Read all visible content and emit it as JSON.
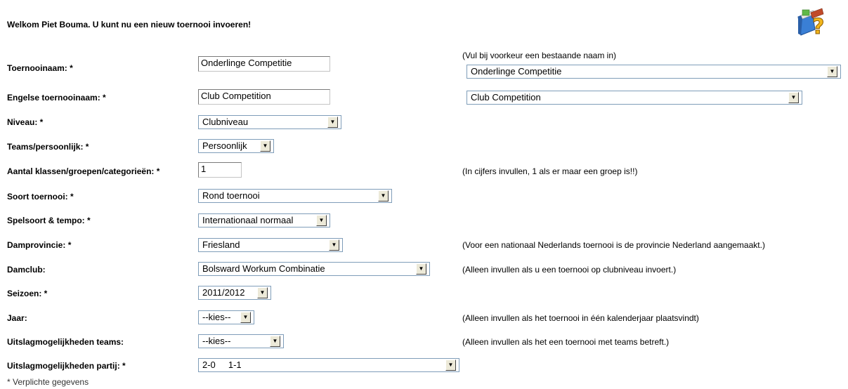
{
  "header": {
    "welcome": "Welkom Piet Bouma. U kunt nu een nieuw toernooi invoeren!"
  },
  "icons": {
    "help": "help-book-question-icon"
  },
  "form": {
    "tournament_name_label": "Toernooinaam: *",
    "tournament_name_value": "Onderlinge Competitie",
    "tournament_name_hint": "(Vul bij voorkeur een bestaande naam in)",
    "tournament_name_existing": "Onderlinge Competitie",
    "english_name_label": "Engelse toernooinaam: *",
    "english_name_value": "Club Competition",
    "english_name_existing": "Club Competition",
    "level_label": "Niveau: *",
    "level_value": "Clubniveau",
    "teams_label": "Teams/persoonlijk: *",
    "teams_value": "Persoonlijk",
    "groups_label": "Aantal klassen/groepen/categorieën: *",
    "groups_value": "1",
    "groups_hint": "(In cijfers invullen, 1 als er maar een groep is!!)",
    "type_label": "Soort toernooi: *",
    "type_value": "Rond toernooi",
    "game_label": "Spelsoort & tempo: *",
    "game_value": "Internationaal normaal",
    "province_label": "Damprovincie: *",
    "province_value": "Friesland",
    "province_hint": "(Voor een nationaal Nederlands toernooi is de provincie Nederland aangemaakt.)",
    "club_label": "Damclub:",
    "club_value": "Bolsward Workum Combinatie",
    "club_hint": "(Alleen invullen als u een toernooi op clubniveau invoert.)",
    "season_label": "Seizoen: *",
    "season_value": "2011/2012",
    "year_label": "Jaar:",
    "year_value": "--kies--",
    "year_hint": "(Alleen invullen als het toernooi in één kalenderjaar plaatsvindt)",
    "team_results_label": "Uitslagmogelijkheden teams:",
    "team_results_value": "--kies--",
    "team_results_hint": "(Alleen invullen als het een toernooi met teams betreft.)",
    "game_results_label": "Uitslagmogelijkheden partij: *",
    "game_results_value": "2-0     1-1"
  },
  "footer": {
    "note": "* Verplichte gegevens"
  }
}
